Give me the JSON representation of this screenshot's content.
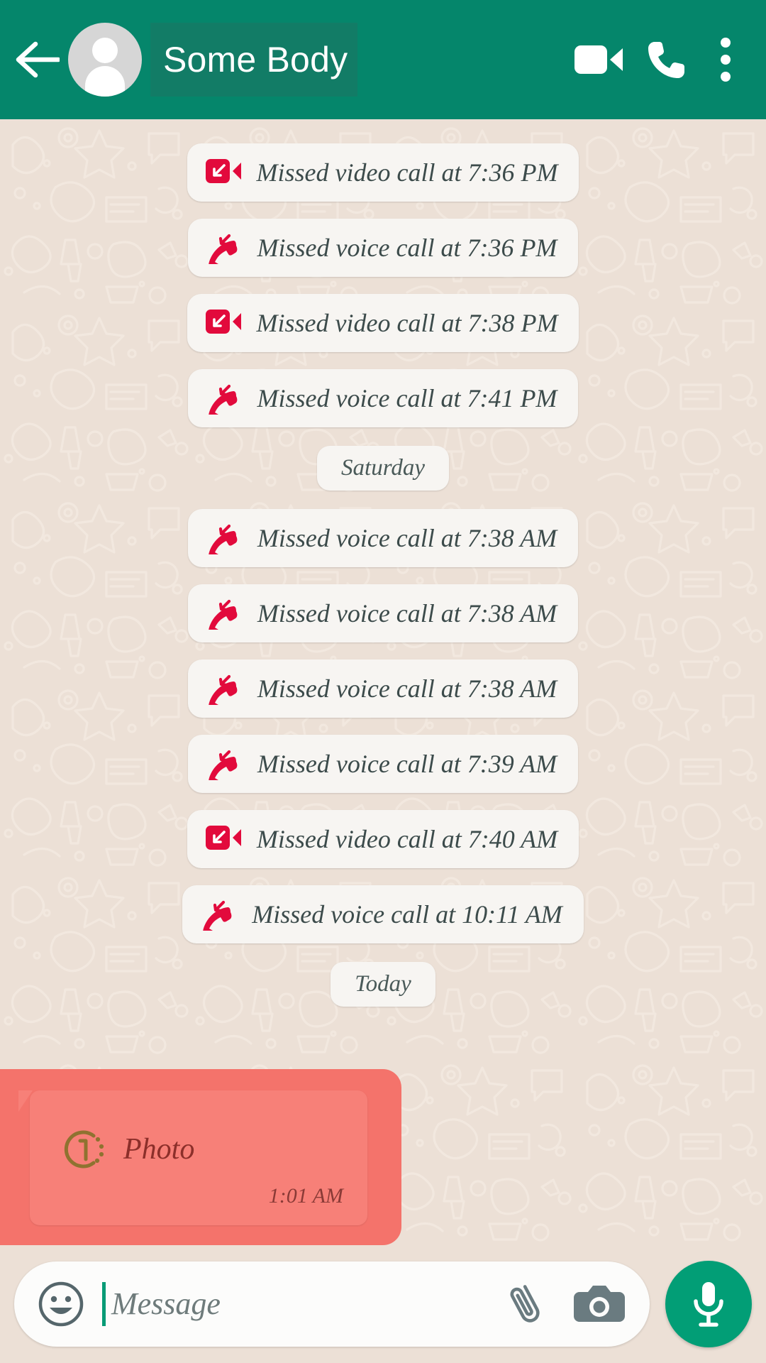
{
  "header": {
    "back_icon": "arrow-left-icon",
    "avatar_icon": "default-contact-avatar",
    "title": "Some Body",
    "video_call_icon": "video-camera-icon",
    "voice_call_icon": "phone-icon",
    "overflow_icon": "more-vertical-icon",
    "background_color": "#05866B"
  },
  "chat": {
    "background_color": "#ECE0D6",
    "bubble_color": "#F7F5F2",
    "missed_call_icon_color": "#E20A3C",
    "items": [
      {
        "kind": "call",
        "call_type": "video",
        "text": "Missed video call at 7:36 PM",
        "icon": "missed-video-call-icon"
      },
      {
        "kind": "call",
        "call_type": "voice",
        "text": "Missed voice call at 7:36 PM",
        "icon": "missed-voice-call-icon"
      },
      {
        "kind": "call",
        "call_type": "video",
        "text": "Missed video call at 7:38 PM",
        "icon": "missed-video-call-icon"
      },
      {
        "kind": "call",
        "call_type": "voice",
        "text": "Missed voice call at 7:41 PM",
        "icon": "missed-voice-call-icon"
      },
      {
        "kind": "date",
        "text": "Saturday"
      },
      {
        "kind": "call",
        "call_type": "voice",
        "text": "Missed voice call at 7:38 AM",
        "icon": "missed-voice-call-icon"
      },
      {
        "kind": "call",
        "call_type": "voice",
        "text": "Missed voice call at 7:38 AM",
        "icon": "missed-voice-call-icon"
      },
      {
        "kind": "call",
        "call_type": "voice",
        "text": "Missed voice call at 7:38 AM",
        "icon": "missed-voice-call-icon"
      },
      {
        "kind": "call",
        "call_type": "voice",
        "text": "Missed voice call at 7:39 AM",
        "icon": "missed-voice-call-icon"
      },
      {
        "kind": "call",
        "call_type": "video",
        "text": "Missed video call at 7:40 AM",
        "icon": "missed-video-call-icon"
      },
      {
        "kind": "call",
        "call_type": "voice",
        "text": "Missed voice call at 10:11 AM",
        "icon": "missed-voice-call-icon"
      },
      {
        "kind": "date",
        "text": "Today"
      }
    ]
  },
  "photo_message": {
    "label": "Photo",
    "timestamp": "1:01 AM",
    "view_once_icon": "view-once-photo-icon",
    "selected": true,
    "selection_color": "#F4736B",
    "bubble_color": "#F78078"
  },
  "input_bar": {
    "emoji_icon": "emoji-smiley-icon",
    "placeholder": "Message",
    "value": "",
    "attach_icon": "paperclip-icon",
    "camera_icon": "camera-icon",
    "mic_icon": "microphone-icon",
    "mic_button_color": "#029E76"
  }
}
